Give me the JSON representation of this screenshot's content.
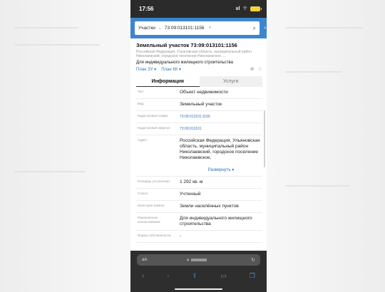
{
  "status": {
    "time": "17:56",
    "signal": "ııl",
    "wifi": "⌔"
  },
  "search": {
    "category": "Участки",
    "query": "73:09:013101:1156"
  },
  "plot": {
    "title": "Земельный участок 73:09:013101:1156",
    "address": "Российская Федерация, Ульяновская область, муниципальный район Николаевский, городское поселение Николаевское, …",
    "use": "Для индивидуального жилищного строительства",
    "link_zu": "План ЗУ ▾",
    "link_kk": "План КК ▾"
  },
  "tabs": [
    {
      "label": "Информация"
    },
    {
      "label": "Услуги"
    }
  ],
  "rows": [
    {
      "label": "Тип:",
      "value": "Объект недвижимости"
    },
    {
      "label": "Вид:",
      "value": "Земельный участок"
    },
    {
      "label": "Кадастровый номер:",
      "value": "73:09:013101:1156"
    },
    {
      "label": "Кадастровый квартал:",
      "value": "73:09:013101"
    },
    {
      "label": "Адрес:",
      "value": "Российская Федерация, Ульяновская область, муниципальный район Николаевский, городское поселение Николаевское,"
    },
    {
      "label": "Площадь уточненная:",
      "value": "1 292 кв. м"
    },
    {
      "label": "Статус:",
      "value": "Учтенный"
    },
    {
      "label": "Категория земель:",
      "value": "Земли населённых пунктов"
    },
    {
      "label": "Разрешенное использование:",
      "value": "Для индивидуального жилищного строительства"
    },
    {
      "label": "Форма собственности:",
      "value": "-"
    }
  ],
  "expand_label": "Развернуть ▾",
  "browser": {
    "aa": "aA",
    "reload": "↻"
  },
  "colors": {
    "accent": "#3d86cf",
    "link": "#2f73bd"
  }
}
